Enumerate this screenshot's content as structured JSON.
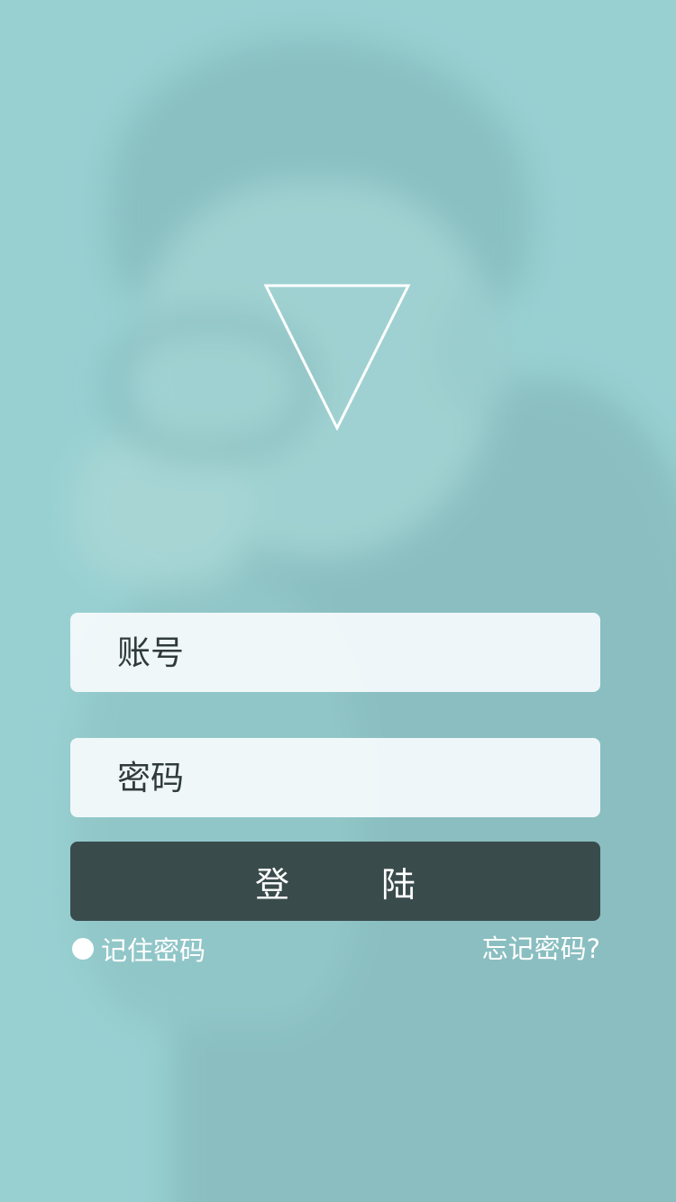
{
  "login_form": {
    "account_placeholder": "账号",
    "password_placeholder": "密码",
    "login_button_label": "登陆",
    "remember_password_label": "记住密码",
    "forgot_password_label": "忘记密码?"
  },
  "icons": {
    "logo": "inverted-triangle-outline",
    "remember_toggle": "filled-circle"
  },
  "colors": {
    "background": "#98d0d2",
    "field_background": "#f5fafc",
    "button_background": "#3a4b4c",
    "text_light": "#ffffff",
    "text_dark": "#2f3b3b"
  }
}
